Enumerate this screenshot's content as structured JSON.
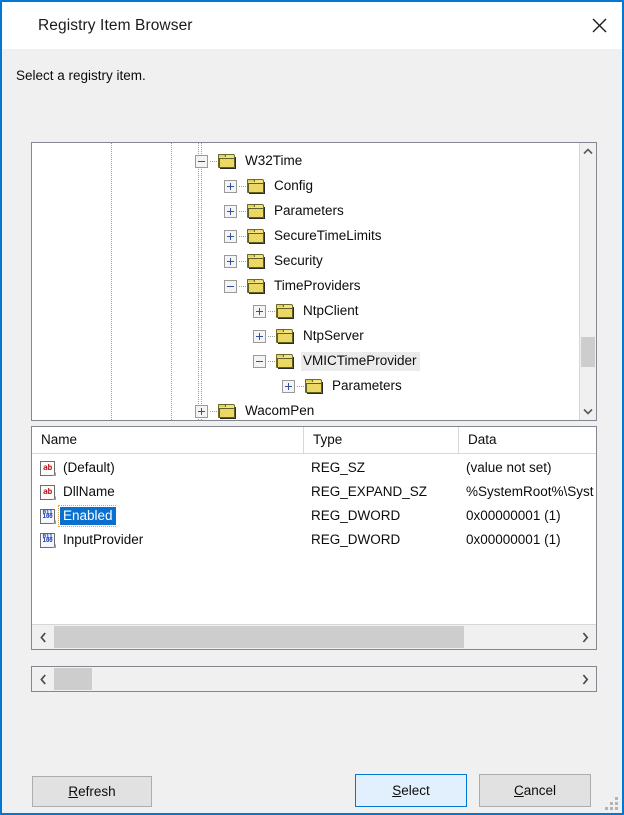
{
  "window": {
    "title": "Registry Item Browser",
    "close_icon": "close-icon",
    "border_color": "#0078d7",
    "body_background": "#f0f0f0"
  },
  "instruction": "Select a registry item.",
  "tree": {
    "nodes": [
      {
        "label": "W32Time",
        "depth": 0,
        "expander": "minus",
        "selected": false
      },
      {
        "label": "Config",
        "depth": 1,
        "expander": "plus",
        "selected": false
      },
      {
        "label": "Parameters",
        "depth": 1,
        "expander": "plus",
        "selected": false
      },
      {
        "label": "SecureTimeLimits",
        "depth": 1,
        "expander": "plus",
        "selected": false
      },
      {
        "label": "Security",
        "depth": 1,
        "expander": "plus",
        "selected": false
      },
      {
        "label": "TimeProviders",
        "depth": 1,
        "expander": "minus",
        "selected": false
      },
      {
        "label": "NtpClient",
        "depth": 2,
        "expander": "plus",
        "selected": false
      },
      {
        "label": "NtpServer",
        "depth": 2,
        "expander": "plus",
        "selected": false
      },
      {
        "label": "VMICTimeProvider",
        "depth": 2,
        "expander": "minus",
        "selected": true
      },
      {
        "label": "Parameters",
        "depth": 3,
        "expander": "plus",
        "selected": false
      },
      {
        "label": "WacomPen",
        "depth": 0,
        "expander": "plus",
        "selected": false
      }
    ],
    "scrollbar": {
      "up_icon": "chevron-up-icon",
      "down_icon": "chevron-down-icon"
    }
  },
  "list": {
    "columns": [
      "Name",
      "Type",
      "Data"
    ],
    "rows": [
      {
        "icon": "string-value-icon",
        "name": "(Default)",
        "type": "REG_SZ",
        "data": "(value not set)",
        "selected": false
      },
      {
        "icon": "string-value-icon",
        "name": "DllName",
        "type": "REG_EXPAND_SZ",
        "data": "%SystemRoot%\\Syst",
        "selected": false
      },
      {
        "icon": "dword-value-icon",
        "name": "Enabled",
        "type": "REG_DWORD",
        "data": "0x00000001 (1)",
        "selected": true
      },
      {
        "icon": "dword-value-icon",
        "name": "InputProvider",
        "type": "REG_DWORD",
        "data": "0x00000001 (1)",
        "selected": false
      }
    ],
    "scrollbar": {
      "left_icon": "chevron-left-icon",
      "right_icon": "chevron-right-icon"
    }
  },
  "outer_scrollbar": {
    "left_icon": "chevron-left-icon",
    "right_icon": "chevron-right-icon"
  },
  "buttons": {
    "refresh": {
      "label": "Refresh",
      "accelerator": "R"
    },
    "select": {
      "label": "Select",
      "accelerator": "S",
      "is_default": true,
      "accent": "#0078d7"
    },
    "cancel": {
      "label": "Cancel",
      "accelerator": "C"
    }
  }
}
